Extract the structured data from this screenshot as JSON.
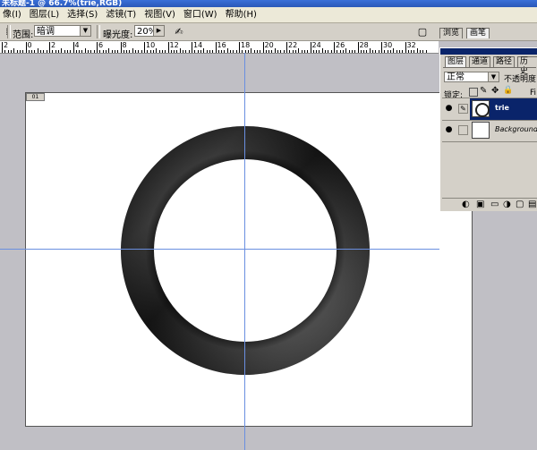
{
  "window": {
    "title": "未标题-1 @ 66.7%(trie,RGB)"
  },
  "menu": [
    "像(I)",
    "图层(L)",
    "选择(S)",
    "滤镜(T)",
    "视图(V)",
    "窗口(W)",
    "帮助(H)"
  ],
  "options": {
    "range_label": "范围:",
    "range_value": "暗调",
    "exposure_label": "曝光度:",
    "exposure_value": "20%"
  },
  "panel_tabs": {
    "tab1": "浏览",
    "tab2": "画笔"
  },
  "ruler": {
    "labels": [
      "2",
      "0",
      "2",
      "4",
      "6",
      "8",
      "10",
      "12",
      "14",
      "16",
      "18",
      "20",
      "22",
      "24",
      "26",
      "28",
      "30",
      "32"
    ]
  },
  "layers_panel": {
    "tabs": [
      "图层",
      "通道",
      "路径",
      "历史"
    ],
    "blend_mode": "正常",
    "opacity_label": "不透明度",
    "lock_label": "锁定:",
    "fill_label": "Fi",
    "layers": [
      {
        "name": "trie",
        "selected": true,
        "thumbnail": "ring"
      },
      {
        "name": "Background",
        "selected": false,
        "thumbnail": "white"
      }
    ]
  },
  "canvas": {
    "badge": "01"
  },
  "colors": {
    "guide": "#6a8fe0",
    "selection": "#0a246a",
    "workspace": "#c0bfc5"
  }
}
